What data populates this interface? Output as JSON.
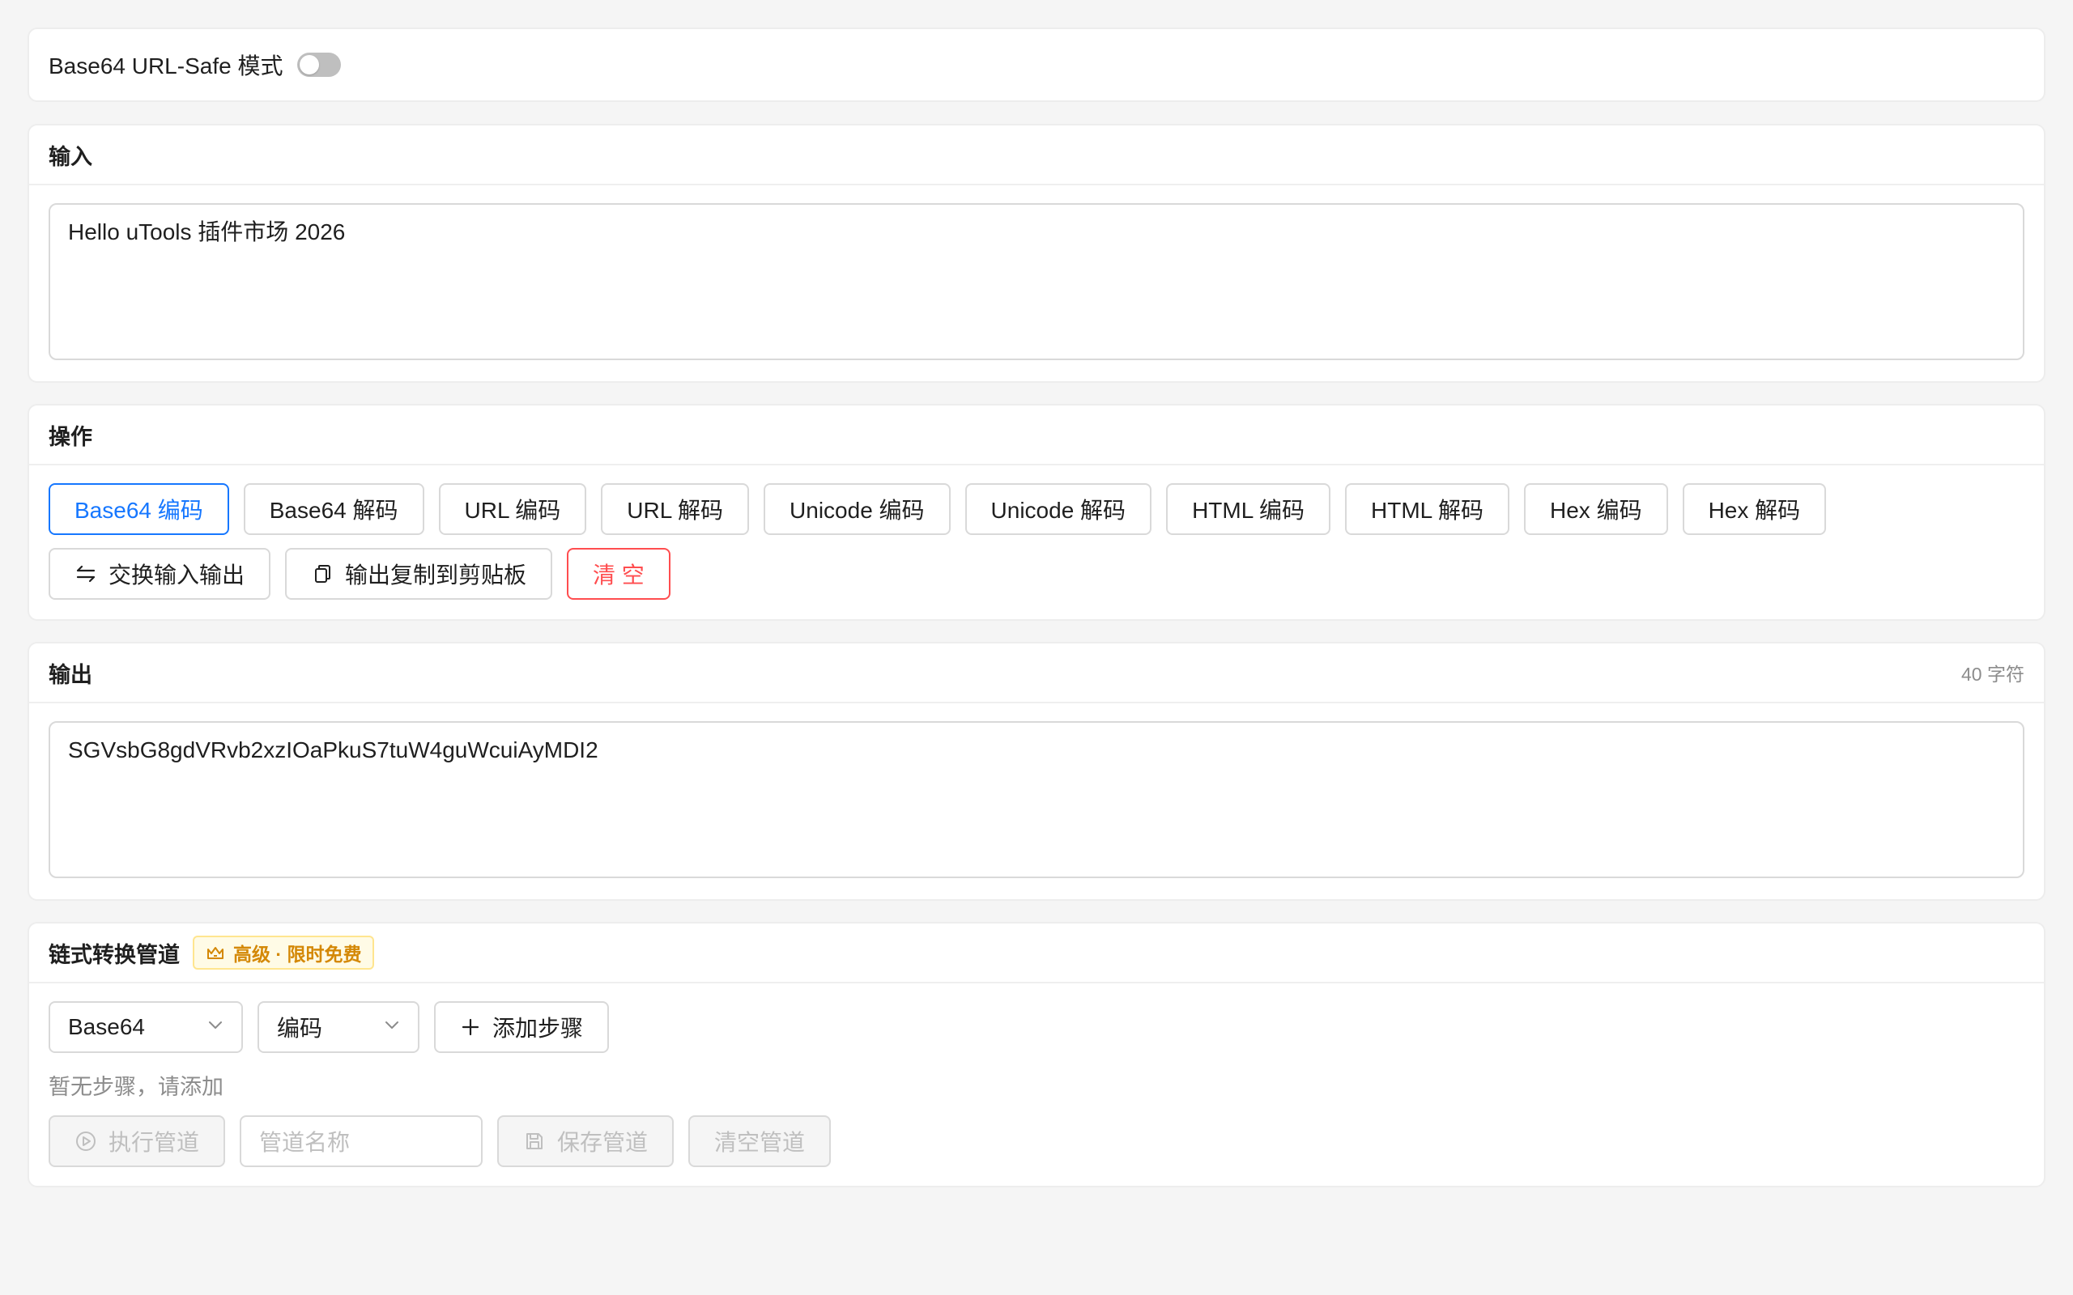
{
  "settings": {
    "url_safe_label": "Base64 URL-Safe 模式",
    "url_safe_enabled": false
  },
  "input_section": {
    "title": "输入",
    "value": "Hello uTools 插件市场 2026"
  },
  "actions_section": {
    "title": "操作",
    "buttons": [
      {
        "label": "Base64 编码",
        "active": true
      },
      {
        "label": "Base64 解码"
      },
      {
        "label": "URL 编码"
      },
      {
        "label": "URL 解码"
      },
      {
        "label": "Unicode 编码"
      },
      {
        "label": "Unicode 解码"
      },
      {
        "label": "HTML 编码"
      },
      {
        "label": "HTML 解码"
      },
      {
        "label": "Hex 编码"
      },
      {
        "label": "Hex 解码"
      }
    ],
    "swap_label": "交换输入输出",
    "copy_label": "输出复制到剪贴板",
    "clear_label": "清 空"
  },
  "output_section": {
    "title": "输出",
    "char_count": "40 字符",
    "value": "SGVsbG8gdVRvb2xzIOaPkuS7tuW4guWcuiAyMDI2"
  },
  "pipeline_section": {
    "title": "链式转换管道",
    "badge": "高级 · 限时免费",
    "format_select": "Base64",
    "mode_select": "编码",
    "add_step_label": "添加步骤",
    "empty_hint": "暂无步骤，请添加",
    "run_label": "执行管道",
    "name_placeholder": "管道名称",
    "save_label": "保存管道",
    "clear_label": "清空管道"
  },
  "colors": {
    "primary": "#1677ff",
    "danger": "#ff4d4f",
    "warning": "#d48806"
  }
}
